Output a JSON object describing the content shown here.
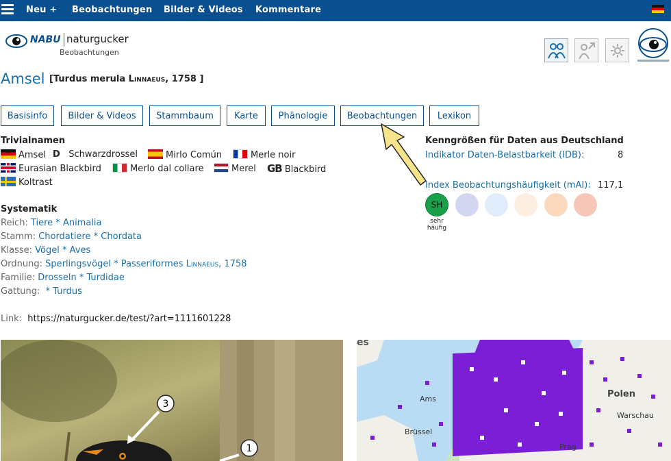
{
  "nav": {
    "items": [
      "Neu +",
      "Beobachtungen",
      "Bilder & Videos",
      "Kommentare"
    ]
  },
  "header": {
    "brand": "NABU",
    "site": "naturgucker",
    "subtitle": "Beobachtungen"
  },
  "species": {
    "name": "Amsel",
    "scientific_prefix": "[Turdus merula",
    "authority": "Linnaeus",
    "scientific_suffix": ", 1758 ]"
  },
  "tabs": [
    "Basisinfo",
    "Bilder & Videos",
    "Stammbaum",
    "Karte",
    "Phänologie",
    "Beobachtungen",
    "Lexikon"
  ],
  "trivialnamen": {
    "heading": "Trivialnamen",
    "entries": [
      {
        "flag": "de",
        "name": "Amsel"
      },
      {
        "flag": "D",
        "name": "Schwarzdrossel"
      },
      {
        "flag": "es",
        "name": "Mirlo Común"
      },
      {
        "flag": "fr",
        "name": "Merle noir"
      },
      {
        "flag": "gb",
        "name": "Eurasian Blackbird"
      },
      {
        "flag": "it",
        "name": "Merlo dal collare"
      },
      {
        "flag": "nl",
        "name": "Merel"
      },
      {
        "flag": "GB",
        "name": "Blackbird"
      },
      {
        "flag": "se",
        "name": "Koltrast"
      }
    ]
  },
  "systematik": {
    "heading": "Systematik",
    "rows": [
      {
        "label": "Reich:",
        "value": "Tiere * Animalia"
      },
      {
        "label": "Stamm:",
        "value": "Chordatiere * Chordata"
      },
      {
        "label": "Klasse:",
        "value": "Vögel * Aves"
      },
      {
        "label": "Ordnung:",
        "value": "Sperlingsvögel * Passeriformes",
        "authority": "Linnaeus",
        "tail": ", 1758"
      },
      {
        "label": "Familie:",
        "value": "Drosseln * Turdidae"
      },
      {
        "label": "Gattung:",
        "value": " * Turdus"
      }
    ],
    "link_label": "Link:",
    "link_value": "https://naturgucker.de/test/?art=1111601228"
  },
  "kenngroessen": {
    "heading": "Kenngrößen für Daten aus Deutschland",
    "idb_label": "Indikator Daten-Belastbarkeit (IDB):",
    "idb_value": "8",
    "mai_label": "Index Beobachtungshäufigkeit (mAI):",
    "mai_value": "117,1",
    "selected_circle": "SH",
    "selected_label_line1": "sehr",
    "selected_label_line2": "häufig",
    "circle_colors": [
      "#1aa04a",
      "#d3d6f0",
      "#e0ecf9",
      "#fdeee2",
      "#fcd9bc",
      "#f6c7b8"
    ]
  },
  "photo_markers": [
    "3",
    "1"
  ],
  "map_labels": [
    "es",
    "Polen",
    "Warschau",
    "Ams",
    "Brüssel",
    "Prag"
  ],
  "colors": {
    "nav_bg": "#0a4f8f",
    "link": "#1a6fa8",
    "map_points": "#7b1fd6"
  }
}
